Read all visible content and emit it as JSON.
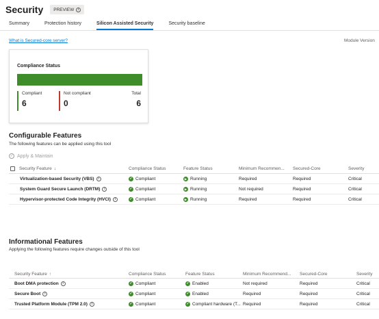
{
  "page": {
    "title": "Security",
    "preview_label": "PREVIEW",
    "info_glyph": "i"
  },
  "tabs": [
    {
      "label": "Summary",
      "active": false
    },
    {
      "label": "Protection history",
      "active": false
    },
    {
      "label": "Silicon Assisted Security",
      "active": true
    },
    {
      "label": "Security baseline",
      "active": false
    }
  ],
  "link_text": "What is Secured-core server?",
  "module_version_label": "Module Version",
  "compliance": {
    "title": "Compliance Status",
    "compliant_label": "Compliant",
    "compliant_value": "6",
    "not_compliant_label": "Not compliant",
    "not_compliant_value": "0",
    "total_label": "Total",
    "total_value": "6",
    "compliant_fraction": 1.0,
    "colors": {
      "compliant": "#3f8d2a",
      "not_compliant": "#c0392b"
    }
  },
  "configurable": {
    "title": "Configurable Features",
    "subtitle": "The following features can be applied using this tool",
    "apply_label": "Apply & Maintain",
    "columns": [
      "Security Feature",
      "Compliance Status",
      "Feature Status",
      "Minimum Recommen...",
      "Secured-Core",
      "Severity"
    ],
    "sort_glyph": "↓",
    "rows": [
      {
        "feature": "Virtualization-based Security (VBS)",
        "compliance": "Compliant",
        "status": "Running",
        "minimum": "Required",
        "secured_core": "Required",
        "severity": "Critical"
      },
      {
        "feature": "System Guard Secure Launch (DRTM)",
        "compliance": "Compliant",
        "status": "Running",
        "minimum": "Not required",
        "secured_core": "Required",
        "severity": "Critical"
      },
      {
        "feature": "Hypervisor-protected Code Integrity (HVCI)",
        "compliance": "Compliant",
        "status": "Running",
        "minimum": "Required",
        "secured_core": "Required",
        "severity": "Critical"
      }
    ]
  },
  "informational": {
    "title": "Informational Features",
    "subtitle": "Applying the following features require changes outside of this tool",
    "columns": [
      "Security Feature",
      "Compliance Status",
      "Feature Status",
      "Minimum Recommend...",
      "Secured-Core",
      "Severity"
    ],
    "sort_glyph": "↑",
    "rows": [
      {
        "feature": "Boot DMA protection",
        "compliance": "Compliant",
        "status": "Enabled",
        "minimum": "Not required",
        "secured_core": "Required",
        "severity": "Critical"
      },
      {
        "feature": "Secure Boot",
        "compliance": "Compliant",
        "status": "Enabled",
        "minimum": "Required",
        "secured_core": "Required",
        "severity": "Critical"
      },
      {
        "feature": "Trusted Platform Module (TPM 2.0)",
        "compliance": "Compliant",
        "status": "Compliant hardware (T...",
        "minimum": "Required",
        "secured_core": "Required",
        "severity": "Critical"
      }
    ]
  },
  "glyphs": {
    "check": "✓",
    "play": "▶",
    "info": "i"
  }
}
